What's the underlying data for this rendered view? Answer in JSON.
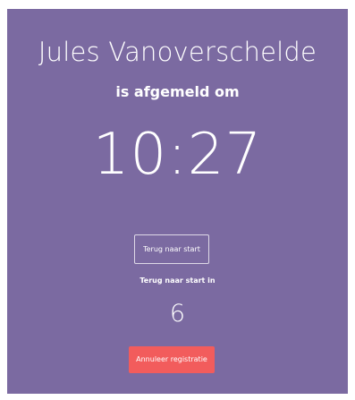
{
  "screen": {
    "name": "Jules Vanoverschelde",
    "subtitle": "is afgemeld om",
    "time": "10:27"
  },
  "actions": {
    "back_label": "Terug naar start",
    "countdown_label": "Terug naar start in",
    "countdown_value": "6",
    "cancel_label": "Annuleer registratie"
  },
  "colors": {
    "background": "#7b6aa1",
    "cancel_button": "#f25c5c",
    "text": "#ffffff"
  }
}
